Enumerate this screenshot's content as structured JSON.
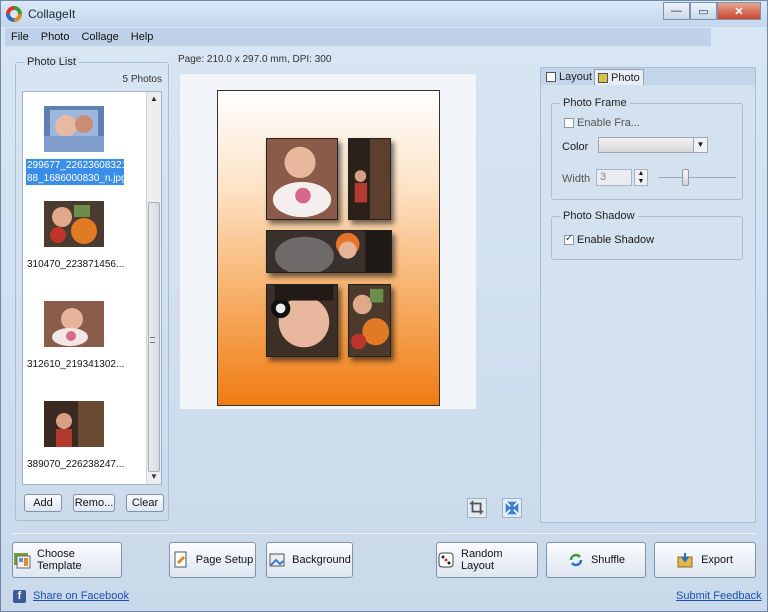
{
  "window": {
    "title": "CollageIt",
    "minimize_label": "—",
    "maximize_label": "▭",
    "close_label": "✕"
  },
  "menu": [
    "File",
    "Photo",
    "Collage",
    "Help"
  ],
  "photo_list": {
    "title": "Photo List",
    "count": "5 Photos",
    "items": [
      {
        "label": "299677_22623608321 88_1686000830_n.jpg",
        "selected": true
      },
      {
        "label": "310470_223871456...",
        "selected": false
      },
      {
        "label": "312610_219341302...",
        "selected": false
      },
      {
        "label": "389070_226238247...",
        "selected": false
      }
    ],
    "buttons": {
      "add": "Add",
      "remove": "Remo...",
      "clear": "Clear"
    }
  },
  "page_info": "Page: 210.0 x 297.0 mm, DPI: 300",
  "right_panel": {
    "tabs": [
      "Layout",
      "Photo"
    ],
    "active_tab": "Photo",
    "photo_frame": {
      "title": "Photo Frame",
      "enable_label": "Enable Fra...",
      "enabled": false,
      "color_label": "Color",
      "width_label": "Width",
      "width_value": "3"
    },
    "photo_shadow": {
      "title": "Photo Shadow",
      "enable_label": "Enable Shadow",
      "enabled": true
    }
  },
  "bottom_buttons": {
    "choose_template": "Choose Template",
    "page_setup": "Page Setup",
    "background": "Background",
    "random_layout": "Random Layout",
    "shuffle": "Shuffle",
    "export": "Export"
  },
  "links": {
    "facebook": "Share on Facebook",
    "feedback": "Submit Feedback"
  },
  "colors": {
    "accent": "#3b8ee8",
    "page_gradient_bottom": "#f07c14",
    "link": "#1b4fb0"
  }
}
